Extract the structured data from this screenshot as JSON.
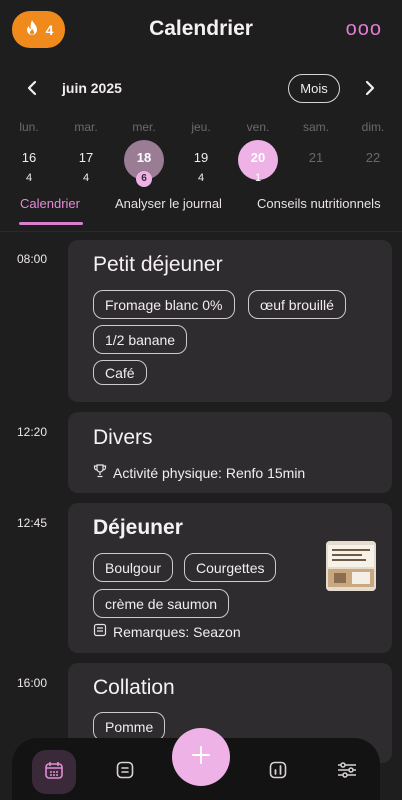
{
  "header": {
    "title": "Calendrier",
    "streak_count": "4",
    "more_label": "ooo"
  },
  "calendar": {
    "month_label": "juin 2025",
    "mode_label": "Mois",
    "days": [
      {
        "dow": "lun.",
        "num": "16",
        "count": "4"
      },
      {
        "dow": "mar.",
        "num": "17",
        "count": "4"
      },
      {
        "dow": "mer.",
        "num": "18",
        "count": "6"
      },
      {
        "dow": "jeu.",
        "num": "19",
        "count": "4"
      },
      {
        "dow": "ven.",
        "num": "20",
        "count": "1"
      },
      {
        "dow": "sam.",
        "num": "21",
        "count": ""
      },
      {
        "dow": "dim.",
        "num": "22",
        "count": ""
      }
    ]
  },
  "tabs": [
    {
      "label": "Calendrier"
    },
    {
      "label": "Analyser le journal"
    },
    {
      "label": "Conseils nutritionnels"
    }
  ],
  "meals": [
    {
      "time": "08:00",
      "title": "Petit déjeuner",
      "items": [
        "Fromage blanc 0%",
        "œuf brouillé",
        "1/2 banane",
        "Café"
      ]
    },
    {
      "time": "12:20",
      "title": "Divers",
      "note": "Activité physique: Renfo 15min"
    },
    {
      "time": "12:45",
      "title": "Déjeuner",
      "items": [
        "Boulgour",
        "Courgettes",
        "crème de saumon"
      ],
      "note": "Remarques: Seazon"
    },
    {
      "time": "16:00",
      "title": "Collation",
      "items": [
        "Pomme"
      ]
    }
  ],
  "colors": {
    "background": "#1f1e1f",
    "card": "#2e2c2e",
    "accent_pink": "#e38cd6",
    "streak_orange": "#f08a1d",
    "selected_day": "#eeb2e6",
    "current_day": "#9a7d95"
  },
  "icons": {
    "streak": "flame-icon",
    "more": "more-dots-icon",
    "prev": "chevron-left-icon",
    "next": "chevron-right-icon",
    "trophy": "trophy-icon",
    "note": "note-icon",
    "nav": [
      "calendar-icon",
      "journal-icon",
      "add-icon",
      "stats-icon",
      "settings-sliders-icon"
    ]
  }
}
